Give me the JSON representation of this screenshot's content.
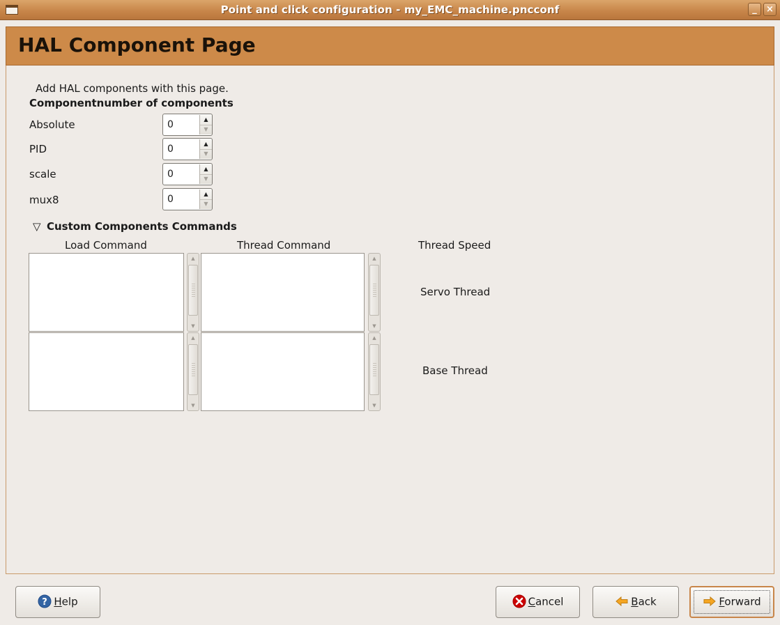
{
  "window": {
    "title": "Point and click configuration - my_EMC_machine.pncconf",
    "minimize_glyph": "_",
    "close_glyph": "×"
  },
  "page": {
    "title": "HAL Component Page",
    "intro": "Add HAL components with this page.",
    "components_header": "Componentnumber of components"
  },
  "components": [
    {
      "label": "Absolute",
      "value": "0"
    },
    {
      "label": "PID",
      "value": "0"
    },
    {
      "label": "scale",
      "value": "0"
    },
    {
      "label": "mux8",
      "value": "0"
    }
  ],
  "custom": {
    "expander_label": "Custom Components Commands",
    "expander_icon": "triangle-down-icon",
    "load_header": "Load Command",
    "thread_header": "Thread Command",
    "speed_header": "Thread Speed",
    "servo_label": "Servo Thread",
    "base_label": "Base Thread",
    "servo_load_text": "",
    "servo_thread_text": "",
    "base_load_text": "",
    "base_thread_text": ""
  },
  "buttons": {
    "help": {
      "mnemonic": "H",
      "rest": "elp",
      "icon": "help-icon"
    },
    "cancel": {
      "mnemonic": "C",
      "rest": "ancel",
      "icon": "cancel-icon"
    },
    "back": {
      "mnemonic": "B",
      "rest": "ack",
      "icon": "back-arrow-icon"
    },
    "forward": {
      "mnemonic": "F",
      "rest": "orward",
      "icon": "forward-arrow-icon"
    }
  },
  "colors": {
    "header_accent": "#cd8a49",
    "titlebar": "#c8864a",
    "window_bg": "#efebe7"
  }
}
